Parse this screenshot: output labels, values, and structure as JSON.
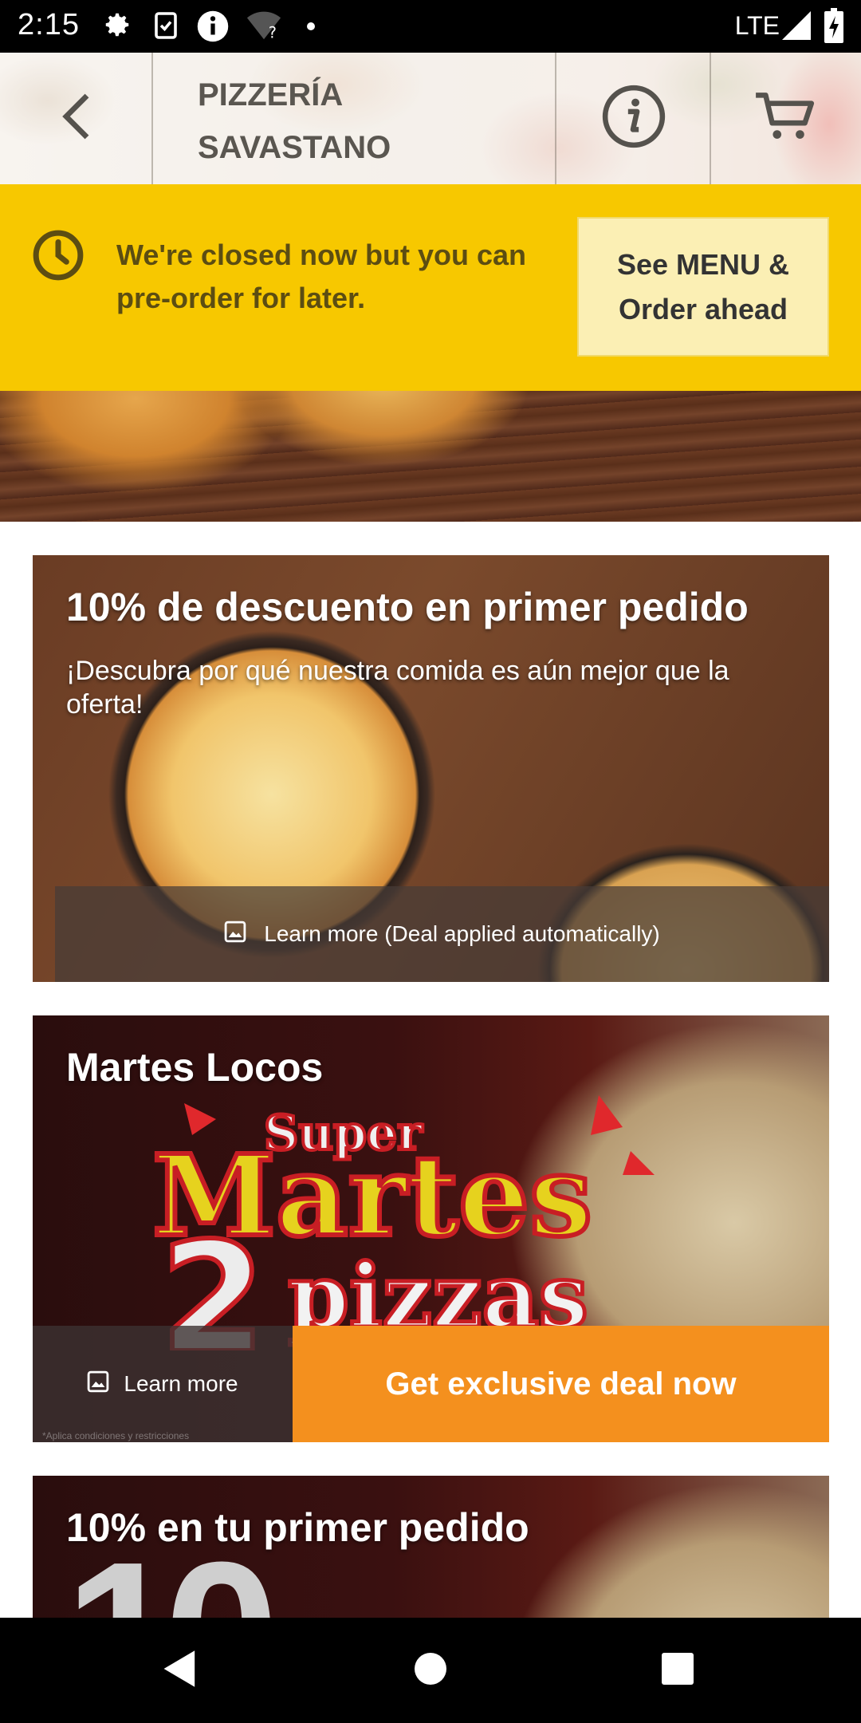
{
  "status_bar": {
    "time": "2:15",
    "network": "LTE",
    "icons": [
      "gear-icon",
      "clipboard-check-icon",
      "info-circle-icon",
      "wifi-question-icon",
      "dot-icon",
      "signal-icon",
      "battery-icon"
    ]
  },
  "header": {
    "title_line1": "PIZZERÍA",
    "title_line2": "SAVASTANO",
    "back_icon": "chevron-left-icon",
    "info_icon": "info-icon",
    "cart_icon": "cart-icon"
  },
  "banner": {
    "message": "We're closed now but you can pre-order for later.",
    "cta_line1": "See MENU &",
    "cta_line2": "Order ahead",
    "background": "#f7c800"
  },
  "deals": [
    {
      "title": "10% de descuento en primer pedido",
      "subtitle": "¡Descubra por qué nuestra comida es aún mejor que la oferta!",
      "learn_more": "Learn more (Deal applied automatically)"
    },
    {
      "title": "Martes Locos",
      "art_line1": "Super",
      "art_line2": "Martes",
      "art_number": "2",
      "art_line3": "pizzas",
      "learn_more": "Learn more",
      "cta": "Get exclusive deal now",
      "fine_print": "*Aplica condiciones y restricciones",
      "cta_color": "#f4901e"
    },
    {
      "title": "10% en tu primer pedido",
      "art_text": "10"
    }
  ],
  "nav_bar": {
    "icons": [
      "back-triangle-icon",
      "home-circle-icon",
      "recents-square-icon"
    ]
  }
}
